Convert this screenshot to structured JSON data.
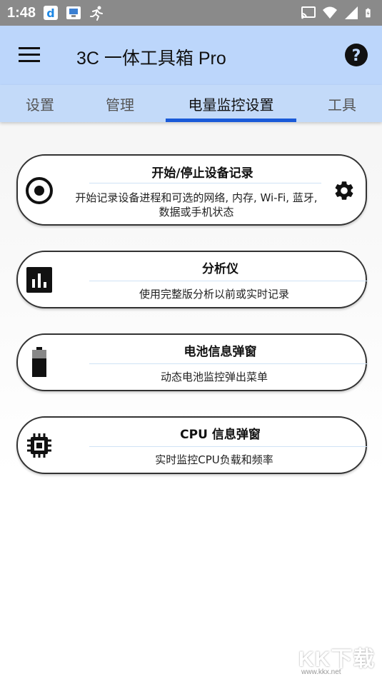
{
  "statusbar": {
    "time": "1:48",
    "left_icons": [
      "download-app-icon",
      "image-app-icon",
      "running-app-icon"
    ],
    "right_icons": [
      "cast-icon",
      "wifi-icon",
      "signal-icon",
      "battery-charging-icon"
    ]
  },
  "appbar": {
    "title": "3C 一体工具箱 Pro",
    "menu_icon": "hamburger-menu-icon",
    "help_icon": "help-icon"
  },
  "tabs": [
    {
      "label": "设置",
      "active": false
    },
    {
      "label": "管理",
      "active": false
    },
    {
      "label": "电量监控设置",
      "active": true
    },
    {
      "label": "工具",
      "active": false
    }
  ],
  "cards": [
    {
      "title": "开始/停止设备记录",
      "description": "开始记录设备进程和可选的网络, 内存, Wi-Fi, 蓝牙, 数据或手机状态",
      "icon": "record-icon",
      "action_icon": "gear-icon"
    },
    {
      "title": "分析仪",
      "description": "使用完整版分析以前或实时记录",
      "icon": "bar-chart-icon"
    },
    {
      "title": "电池信息弹窗",
      "description": "动态电池监控弹出菜单",
      "icon": "battery-icon"
    },
    {
      "title": "CPU 信息弹窗",
      "description": "实时监控CPU负载和频率",
      "icon": "cpu-chip-icon"
    }
  ],
  "watermark": {
    "logo": "KK下载",
    "url": "www.kkx.net"
  },
  "colors": {
    "appbar": "#bcd6fb",
    "tabbar": "#c3daf9",
    "tab_indicator": "#1a5ad8",
    "statusbar": "#8a8a8a"
  }
}
